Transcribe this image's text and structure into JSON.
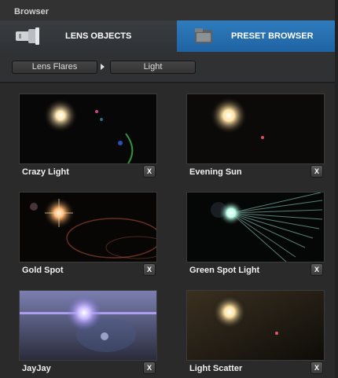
{
  "panel": {
    "title": "Browser"
  },
  "tabs": [
    {
      "label": "LENS OBJECTS",
      "icon": "lens-icon",
      "active": false
    },
    {
      "label": "PRESET BROWSER",
      "icon": "preset-folder-icon",
      "active": true
    }
  ],
  "breadcrumb": [
    "Lens Flares",
    "Light"
  ],
  "presets": [
    {
      "name": "Crazy Light",
      "delete_label": "X"
    },
    {
      "name": "Evening Sun",
      "delete_label": "X"
    },
    {
      "name": "Gold Spot",
      "delete_label": "X"
    },
    {
      "name": "Green Spot Light",
      "delete_label": "X"
    },
    {
      "name": "JayJay",
      "delete_label": "X"
    },
    {
      "name": "Light Scatter",
      "delete_label": "X"
    }
  ],
  "colors": {
    "active_tab": "#1f63a3",
    "panel_bg": "#2a2a2b"
  }
}
